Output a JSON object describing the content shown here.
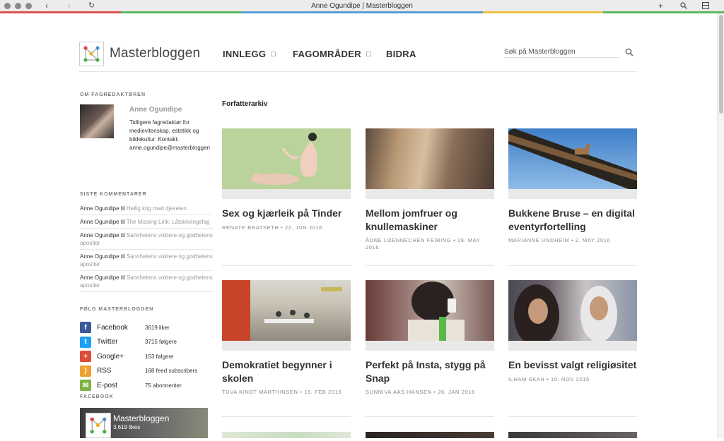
{
  "browser": {
    "title": "Anne Ogundipe | Masterbloggen",
    "stripe_colors": [
      "#d9534f",
      "#5cb85c",
      "#5b9bd5",
      "#5b9bd5",
      "#f0c040",
      "#5cb85c"
    ]
  },
  "header": {
    "brand": "Masterbloggen",
    "nav": [
      {
        "label": "INNLEGG",
        "has_submenu": true
      },
      {
        "label": "FAGOMRÅDER",
        "has_submenu": true
      },
      {
        "label": "BIDRA",
        "has_submenu": false
      }
    ],
    "search": {
      "placeholder": "Søk på Masterbloggen"
    }
  },
  "sidebar": {
    "about_heading": "OM FAGREDAKTØREN",
    "editor_name": "Anne Ogundipe",
    "editor_bio": "Tidligere fagredaktør for medievitenskap, estetikk og bildekultur. Kontakt: anne.ogundipe@masterbloggen",
    "comments_heading": "SISTE KOMMENTARER",
    "comments": [
      {
        "author": "Anne Ogundipe",
        "sep": "til",
        "post": "Hellig krig med djevelen"
      },
      {
        "author": "Anne Ogundipe",
        "sep": "til",
        "post": "The Missing Link: Låtskrivingsfag"
      },
      {
        "author": "Anne Ogundipe",
        "sep": "til",
        "post": "Sannhetens voktere og godhetens apostler"
      },
      {
        "author": "Anne Ogundipe",
        "sep": "til",
        "post": "Sannhetens voktere og godhetens apostler"
      },
      {
        "author": "Anne Ogundipe",
        "sep": "til",
        "post": "Sannhetens voktere og godhetens apostler"
      }
    ],
    "follow_heading": "FØLG MASTERBLOGGEN",
    "follow": [
      {
        "name": "Facebook",
        "count": "3619 liker",
        "icon": "facebook-icon",
        "color": "#3b5998",
        "glyph": "f"
      },
      {
        "name": "Twitter",
        "count": "3715 følgere",
        "icon": "twitter-icon",
        "color": "#1da1f2",
        "glyph": "t"
      },
      {
        "name": "Google+",
        "count": "153 følgere",
        "icon": "google-plus-icon",
        "color": "#dd4b39",
        "glyph": "+"
      },
      {
        "name": "RSS",
        "count": "168 feed subscribers",
        "icon": "rss-icon",
        "color": "#f0a030",
        "glyph": ")"
      },
      {
        "name": "E-post",
        "count": "75 abonnenter",
        "icon": "email-icon",
        "color": "#7cb342",
        "glyph": "✉"
      }
    ],
    "facebook_heading": "FACEBOOK",
    "facebook_widget": {
      "title": "Masterbloggen",
      "likes": "3,619 likes"
    }
  },
  "main": {
    "title": "Forfatterarkiv",
    "posts": [
      {
        "title": "Sex og kjærleik på Tinder",
        "meta": "RENATE BRATSETH • 22. JUN 2016"
      },
      {
        "title": "Mellom jomfruer og knullemaskiner",
        "meta": "ÅDNE LOENNECHEN FEIRING • 19. MAY 2016"
      },
      {
        "title": "Bukkene Bruse – en digital eventyrfortelling",
        "meta": "MARIANNE UNDHEIM • 2. MAY 2016"
      },
      {
        "title": "Demokratiet begynner i skolen",
        "meta": "TUVA KINDT MARTHINSEN • 16. FEB 2016"
      },
      {
        "title": "Perfekt på Insta, stygg på Snap",
        "meta": "SUNNIVA AAS-HANSEN • 26. JAN 2016"
      },
      {
        "title": "En bevisst valgt religiøsitet",
        "meta": "ILHAM SKAH • 10. NOV 2015"
      }
    ]
  }
}
